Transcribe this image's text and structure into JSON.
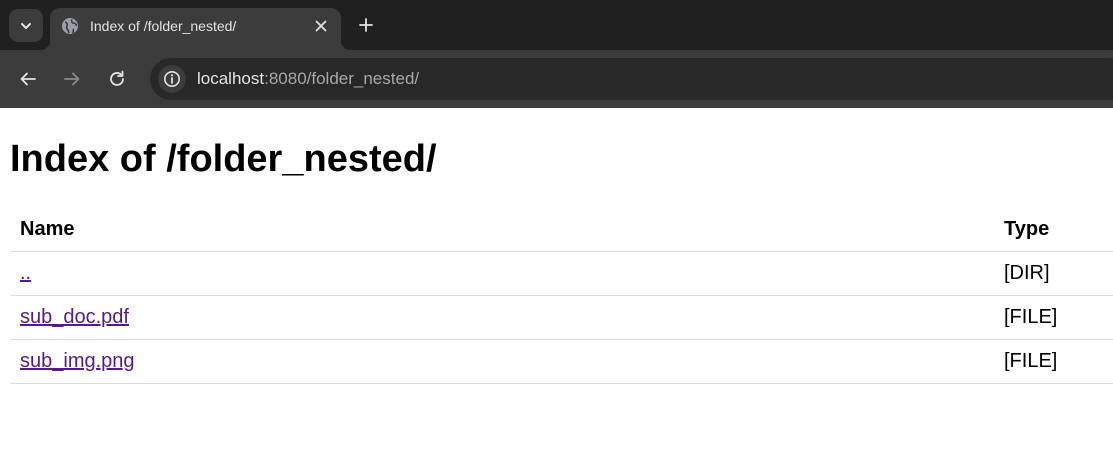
{
  "browser": {
    "tab": {
      "title": "Index of /folder_nested/"
    },
    "address_bar": {
      "host": "localhost",
      "path": ":8080/folder_nested/"
    }
  },
  "page": {
    "heading": "Index of /folder_nested/",
    "columns": {
      "name": "Name",
      "type": "Type"
    },
    "rows": [
      {
        "name": "..",
        "type": "[DIR]"
      },
      {
        "name": "sub_doc.pdf",
        "type": "[FILE]"
      },
      {
        "name": "sub_img.png",
        "type": "[FILE]"
      }
    ]
  },
  "colors": {
    "chrome_dark": "#202020",
    "chrome_toolbar": "#3c3c3c",
    "visited_link": "#551a8b"
  }
}
